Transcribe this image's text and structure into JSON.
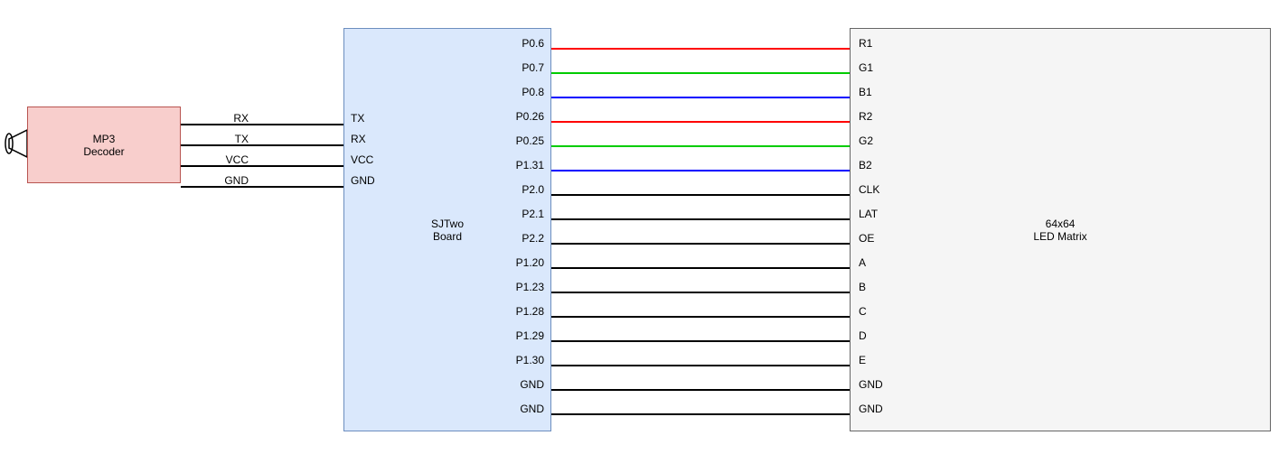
{
  "blocks": {
    "mp3": {
      "title": "MP3\nDecoder"
    },
    "sjtwo": {
      "title": "SJTwo\nBoard"
    },
    "led": {
      "title": "64x64\nLED Matrix"
    }
  },
  "mp3_pins": {
    "rx": "RX",
    "tx": "TX",
    "vcc": "VCC",
    "gnd": "GND"
  },
  "sjtwo_left_pins": {
    "tx": "TX",
    "rx": "RX",
    "vcc": "VCC",
    "gnd": "GND"
  },
  "connections": [
    {
      "sj": "P0.6",
      "led": "R1",
      "color": "red"
    },
    {
      "sj": "P0.7",
      "led": "G1",
      "color": "green"
    },
    {
      "sj": "P0.8",
      "led": "B1",
      "color": "blue"
    },
    {
      "sj": "P0.26",
      "led": "R2",
      "color": "red"
    },
    {
      "sj": "P0.25",
      "led": "G2",
      "color": "green"
    },
    {
      "sj": "P1.31",
      "led": "B2",
      "color": "blue"
    },
    {
      "sj": "P2.0",
      "led": "CLK",
      "color": "black"
    },
    {
      "sj": "P2.1",
      "led": "LAT",
      "color": "black"
    },
    {
      "sj": "P2.2",
      "led": "OE",
      "color": "black"
    },
    {
      "sj": "P1.20",
      "led": "A",
      "color": "black"
    },
    {
      "sj": "P1.23",
      "led": "B",
      "color": "black"
    },
    {
      "sj": "P1.28",
      "led": "C",
      "color": "black"
    },
    {
      "sj": "P1.29",
      "led": "D",
      "color": "black"
    },
    {
      "sj": "P1.30",
      "led": "E",
      "color": "black"
    },
    {
      "sj": "GND",
      "led": "GND",
      "color": "black"
    },
    {
      "sj": "GND",
      "led": "GND",
      "color": "black"
    }
  ]
}
